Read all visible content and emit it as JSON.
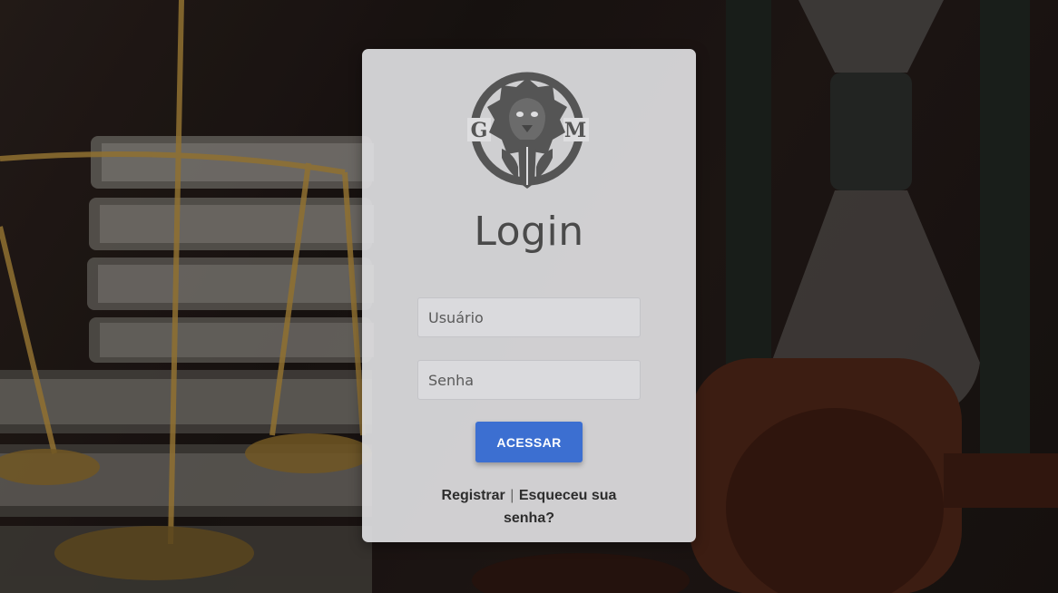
{
  "page": {
    "title": "Login",
    "logo_letters": {
      "left": "G",
      "right": "M"
    }
  },
  "form": {
    "username_placeholder": "Usuário",
    "password_placeholder": "Senha",
    "submit_label": "ACESSAR"
  },
  "links": {
    "register": "Registrar",
    "separator": "|",
    "forgot_password": "Esqueceu sua senha?"
  },
  "colors": {
    "accent": "#3c6fd1",
    "card": "#dedee0",
    "text": "#4a4a4a"
  },
  "background_scene": "law-scales-books-gavel-hourglass"
}
